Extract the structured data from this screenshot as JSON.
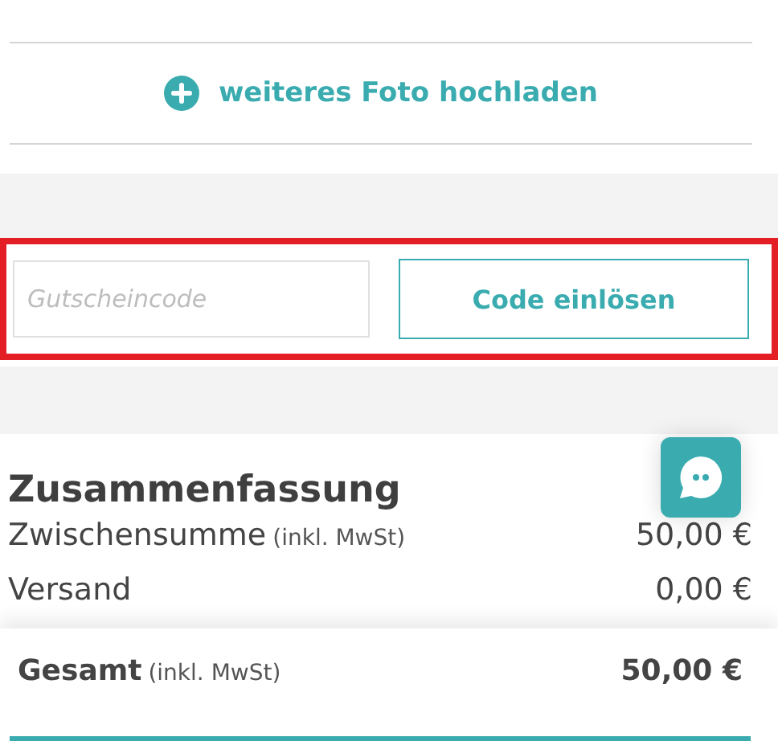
{
  "upload": {
    "label": "weiteres Foto hochladen"
  },
  "coupon": {
    "placeholder": "Gutscheincode",
    "button": "Code einlösen"
  },
  "summary": {
    "title": "Zusammenfassung",
    "rows": [
      {
        "label": "Zwischensumme",
        "note": "(inkl. MwSt)",
        "amount": "50,00 €"
      },
      {
        "label": "Versand",
        "amount": "0,00 €"
      }
    ]
  },
  "total": {
    "label": "Gesamt",
    "note": "(inkl. MwSt)",
    "amount": "50,00 €"
  }
}
